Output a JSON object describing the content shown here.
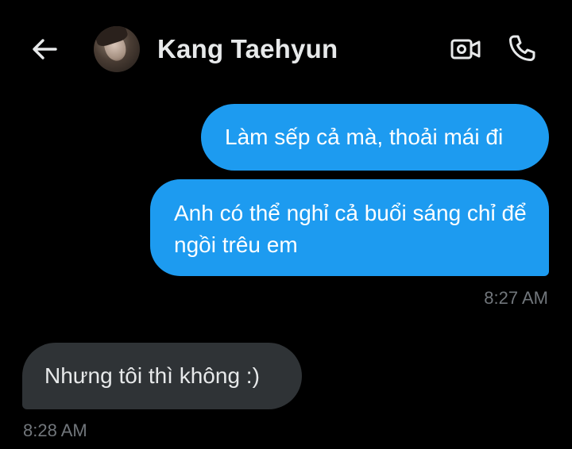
{
  "header": {
    "contact_name": "Kang Taehyun",
    "back_icon": "arrow-left-icon",
    "video_icon": "video-call-icon",
    "call_icon": "phone-icon"
  },
  "messages": [
    {
      "direction": "sent",
      "text": "Làm sếp cả mà, thoải mái đi"
    },
    {
      "direction": "sent",
      "text": "Anh có thể nghỉ cả buổi sáng chỉ để ngồi trêu em",
      "time": "8:27 AM"
    },
    {
      "direction": "received",
      "text": "Nhưng tôi thì không :)",
      "time": "8:28 AM"
    }
  ],
  "colors": {
    "background": "#000000",
    "sent_bubble": "#1d9bf0",
    "received_bubble": "#2f3336",
    "timestamp": "#71767b",
    "text": "#e7e9ea"
  }
}
